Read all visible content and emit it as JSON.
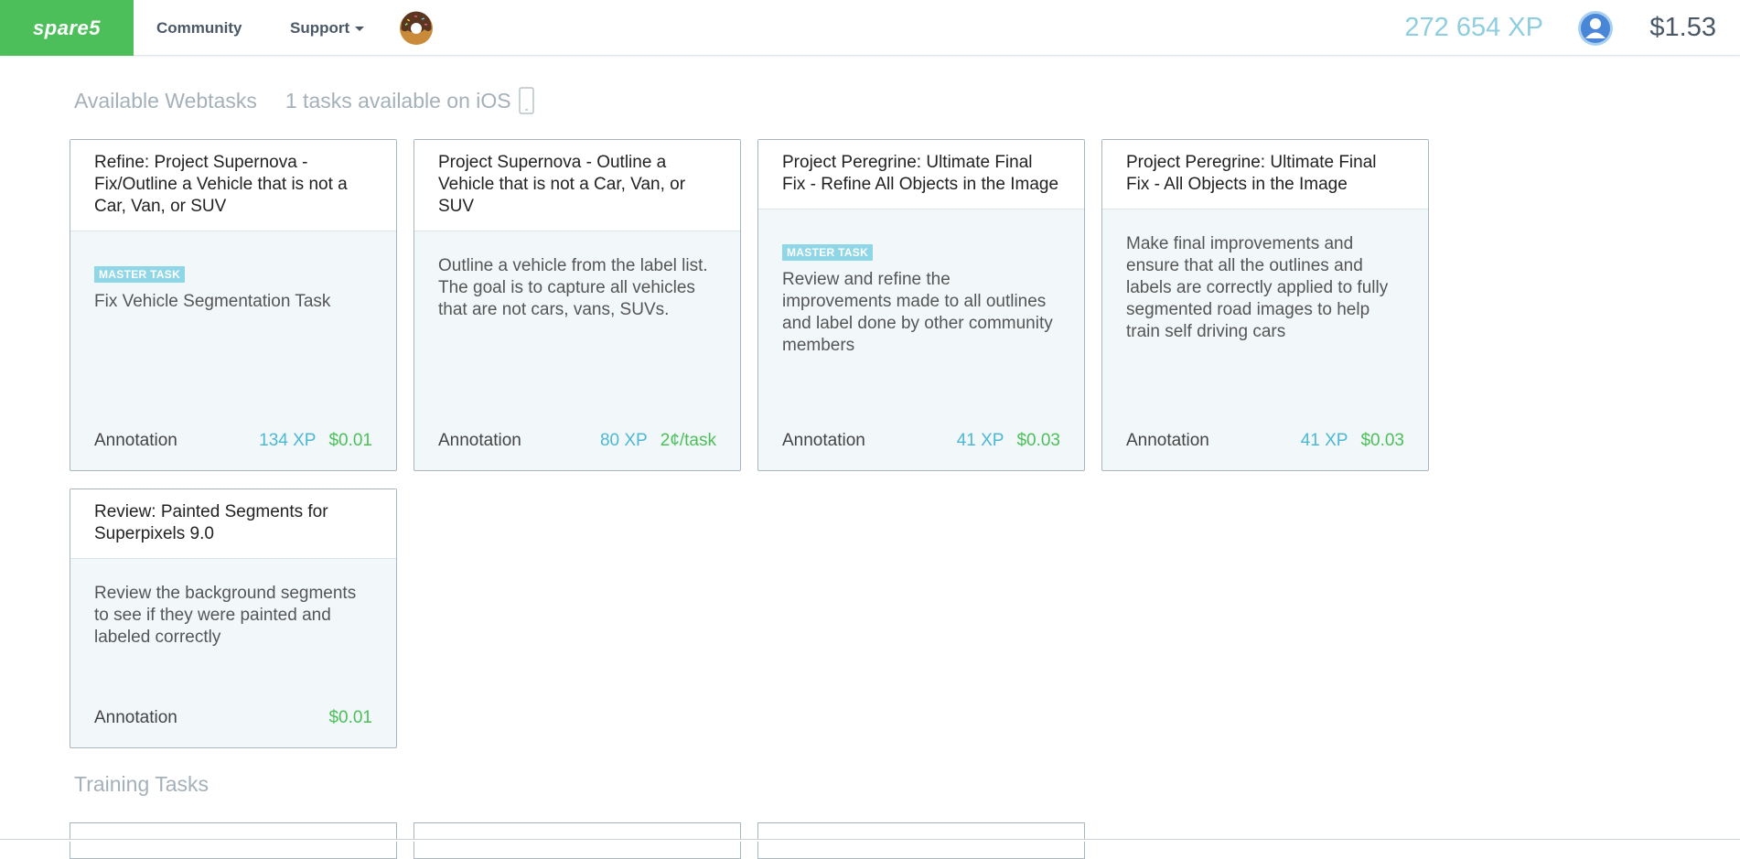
{
  "brand": {
    "logo": "spare5",
    "accent": "#4cbf5b"
  },
  "nav": {
    "community": "Community",
    "support": "Support"
  },
  "user": {
    "xp": "272 654 XP",
    "balance": "$1.53"
  },
  "available": {
    "title": "Available Webtasks",
    "ios_count": "1 tasks available on iOS"
  },
  "tasks": [
    {
      "title": "Refine: Project Supernova - Fix/Outline a Vehicle that is not a Car, Van, or SUV",
      "badge": "MASTER TASK",
      "description": "Fix Vehicle Segmentation Task",
      "type": "Annotation",
      "xp": "134 XP",
      "pay": "$0.01"
    },
    {
      "title": "Project Supernova - Outline a Vehicle that is not a Car, Van, or SUV",
      "description": "Outline a vehicle from the label list. The goal is to capture all vehicles that are not cars, vans, SUVs.",
      "type": "Annotation",
      "xp": "80 XP",
      "pay": "2¢/task"
    },
    {
      "title": "Project Peregrine: Ultimate Final Fix - Refine All Objects in the Image",
      "badge": "MASTER TASK",
      "description": "Review and refine the improvements made to all outlines and label done by other community members",
      "type": "Annotation",
      "xp": "41 XP",
      "pay": "$0.03"
    },
    {
      "title": "Project Peregrine: Ultimate Final Fix - All Objects in the Image",
      "description": "Make final improvements and ensure that all the outlines and labels are correctly applied to fully segmented road images to help train self driving cars",
      "type": "Annotation",
      "xp": "41 XP",
      "pay": "$0.03"
    },
    {
      "title": "Review: Painted Segments for Superpixels 9.0",
      "description": "Review the background segments to see if they were painted and labeled correctly",
      "type": "Annotation",
      "pay": "$0.01"
    }
  ],
  "training": {
    "title": "Training Tasks"
  },
  "icons": [
    "donut-icon",
    "user-avatar-icon",
    "phone-icon",
    "caret-down-icon"
  ]
}
